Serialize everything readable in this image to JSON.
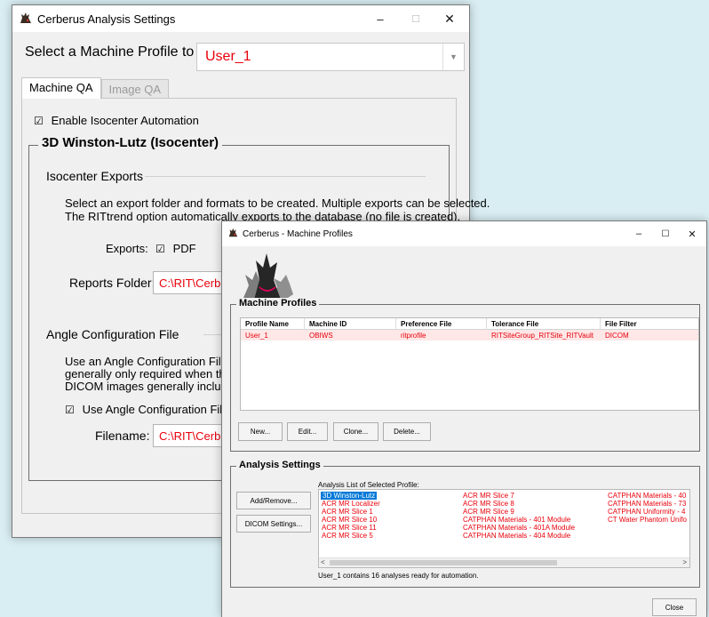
{
  "settings_window": {
    "title": "Cerberus Analysis Settings",
    "controls": {
      "minimize": "–",
      "maximize": "☐",
      "close": "✕"
    },
    "profile_label": "Select a Machine Profile to edit:",
    "profile_value": "User_1",
    "tabs": [
      {
        "label": "Machine QA",
        "active": true
      },
      {
        "label": "Image QA",
        "active": false
      }
    ],
    "enable_isocenter": {
      "label": "Enable Isocenter Automation",
      "checked": true
    },
    "winston_lutz": {
      "title": "3D Winston-Lutz (Isocenter)",
      "exports": {
        "heading": "Isocenter Exports",
        "desc_line1": "Select an export folder and formats to be created. Multiple exports can be selected.",
        "desc_line2": "The RITtrend option automatically exports to the database (no file is created).",
        "exports_label": "Exports:",
        "pdf": {
          "label": "PDF",
          "checked": true
        },
        "reports_folder_label": "Reports Folder:",
        "reports_folder_value": "C:\\RIT\\Cerberus"
      },
      "angle_config": {
        "heading": "Angle Configuration File",
        "desc_line1": "Use an Angle Configuration File to loa",
        "desc_line2": "generally only required when the ang",
        "desc_line3": "DICOM images generally include ang",
        "use_file": {
          "label": "Use Angle Configuration File",
          "checked": true
        },
        "filename_label": "Filename:",
        "filename_value": "C:\\RIT\\Cerberus"
      }
    }
  },
  "profiles_window": {
    "title": "Cerberus - Machine Profiles",
    "controls": {
      "minimize": "–",
      "maximize": "☐",
      "close": "✕"
    },
    "machine_profiles": {
      "title": "Machine Profiles",
      "columns": [
        "Profile Name",
        "Machine ID",
        "Preference File",
        "Tolerance File",
        "File Filter"
      ],
      "rows": [
        [
          "User_1",
          "OBIWS",
          "ritprofile",
          "RITSiteGroup_RITSite_RITVault",
          "DICOM"
        ]
      ],
      "buttons": {
        "new": "New...",
        "edit": "Edit...",
        "clone": "Clone...",
        "delete": "Delete..."
      }
    },
    "analysis_settings": {
      "title": "Analysis Settings",
      "add_remove": "Add/Remove...",
      "dicom_settings": "DICOM Settings...",
      "list_label": "Analysis List of Selected Profile:",
      "col1": [
        "3D Winston-Lutz",
        "ACR MR Localizer",
        "ACR MR Slice 1",
        "ACR MR Slice 10",
        "ACR MR Slice 11",
        "ACR MR Slice 5"
      ],
      "col2": [
        "ACR MR Slice 7",
        "ACR MR Slice 8",
        "ACR MR Slice 9",
        "CATPHAN Materials - 401 Module",
        "CATPHAN Materials - 401A Module",
        "CATPHAN Materials - 404 Module"
      ],
      "col3": [
        "CATPHAN Materials - 40",
        "CATPHAN Materials - 73",
        "CATPHAN Uniformity - 4",
        "CT Water Phantom Unifo"
      ],
      "scroll_left": "<",
      "scroll_right": ">",
      "status": "User_1 contains 16 analyses ready for automation."
    },
    "close_button": "Close"
  }
}
